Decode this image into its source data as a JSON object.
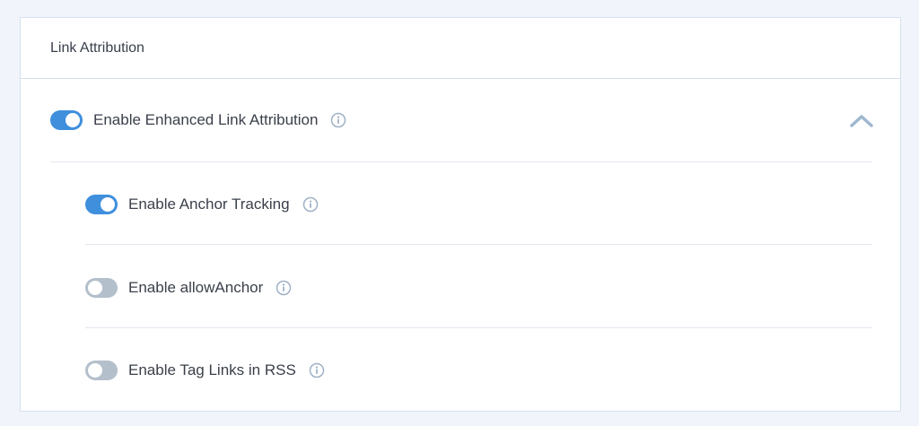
{
  "section": {
    "title": "Link Attribution"
  },
  "main_setting": {
    "label": "Enable Enhanced Link Attribution",
    "enabled": true,
    "expanded": true
  },
  "sub_settings": [
    {
      "label": "Enable Anchor Tracking",
      "enabled": true
    },
    {
      "label": "Enable allowAnchor",
      "enabled": false
    },
    {
      "label": "Enable Tag Links in RSS",
      "enabled": false
    }
  ],
  "colors": {
    "toggle_on": "#3f8fdd",
    "toggle_off": "#b4bfcc",
    "info_icon": "#9fb1c6",
    "chevron": "#9fb7cf"
  },
  "icons": {
    "info": "info-icon",
    "collapse": "chevron-up-icon"
  }
}
